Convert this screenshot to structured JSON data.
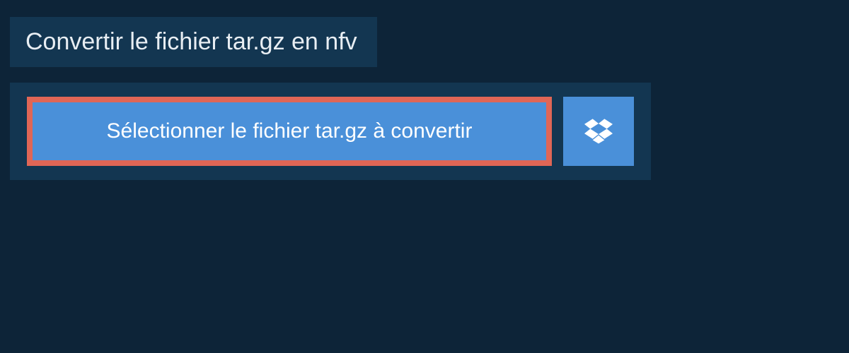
{
  "header": {
    "title": "Convertir le fichier tar.gz en nfv"
  },
  "controls": {
    "select_file_label": "Sélectionner le fichier tar.gz à convertir"
  }
}
